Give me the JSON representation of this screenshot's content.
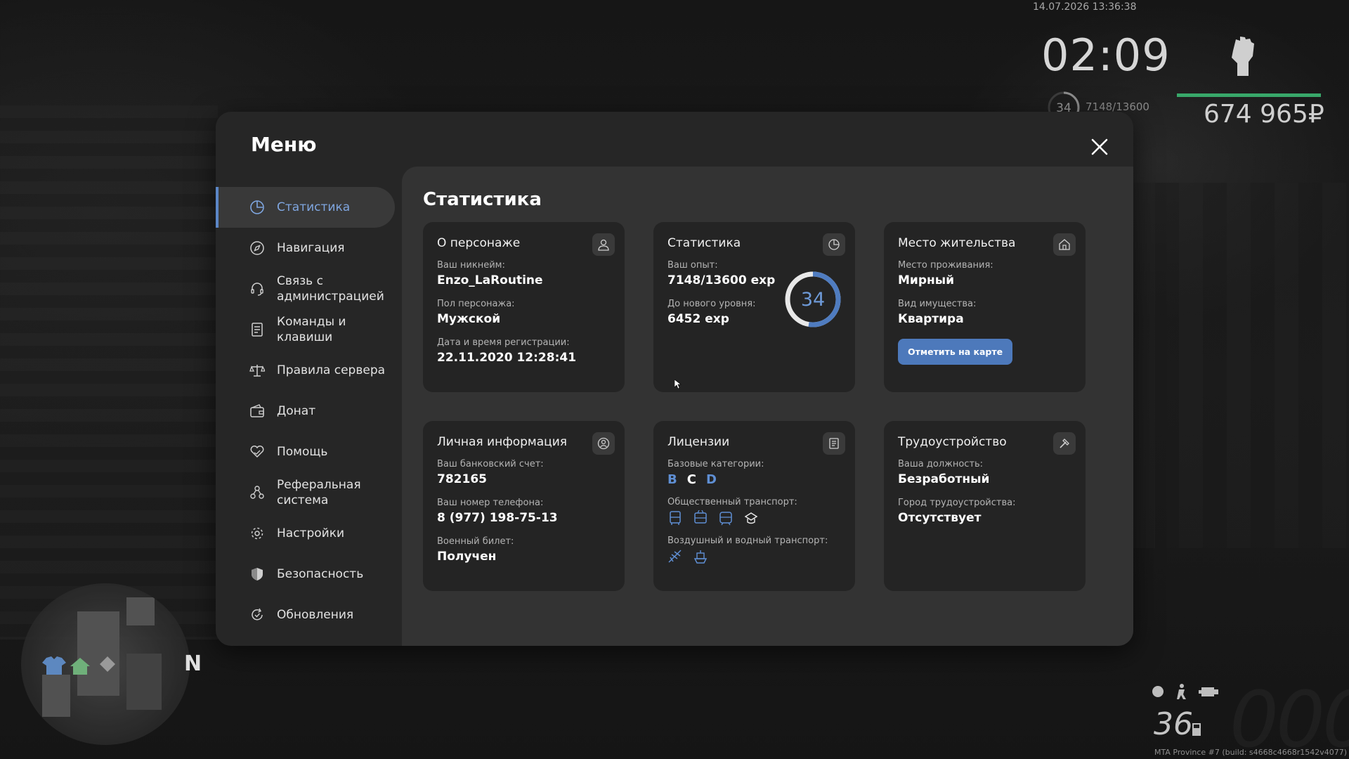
{
  "hud": {
    "datetime": "14.07.2026 13:36:38",
    "clock": "02:09",
    "level": "34",
    "exp": "7148/13600",
    "money": "674 965₽",
    "speed": "36",
    "speed_ghost": "000",
    "build": "MTA Province #7 (build: s4668c4668r1542v4077)",
    "minimap_north": "N"
  },
  "menu": {
    "title": "Меню",
    "items": [
      {
        "label": "Статистика",
        "icon": "chart-icon",
        "active": true
      },
      {
        "label": "Навигация",
        "icon": "compass-icon"
      },
      {
        "label": "Связь с\nадминистрацией",
        "icon": "headset-icon"
      },
      {
        "label": "Команды и\nклавиши",
        "icon": "document-icon"
      },
      {
        "label": "Правила сервера",
        "icon": "scales-icon"
      },
      {
        "label": "Донат",
        "icon": "wallet-icon"
      },
      {
        "label": "Помощь",
        "icon": "heart-hands-icon"
      },
      {
        "label": "Реферальная\nсистема",
        "icon": "referral-icon"
      },
      {
        "label": "Настройки",
        "icon": "gear-icon"
      },
      {
        "label": "Безопасность",
        "icon": "shield-icon"
      },
      {
        "label": "Обновления",
        "icon": "refresh-icon"
      }
    ]
  },
  "content": {
    "title": "Статистика",
    "character": {
      "title": "О персонаже",
      "nickname_label": "Ваш никнейм:",
      "nickname": "Enzo_LaRoutine",
      "gender_label": "Пол персонажа:",
      "gender": "Мужской",
      "reg_label": "Дата и время регистрации:",
      "reg": "22.11.2020 12:28:41"
    },
    "stats": {
      "title": "Статистика",
      "exp_label": "Ваш опыт:",
      "exp": "7148/13600 exp",
      "next_label": "До нового уровня:",
      "next": "6452 exp",
      "level": "34",
      "progress": 0.5256
    },
    "residence": {
      "title": "Место жительства",
      "place_label": "Место проживания:",
      "place": "Мирный",
      "property_label": "Вид имущества:",
      "property": "Квартира",
      "map_button": "Отметить на карте"
    },
    "personal": {
      "title": "Личная информация",
      "bank_label": "Ваш банковский счет:",
      "bank": "782165",
      "phone_label": "Ваш номер телефона:",
      "phone": "8 (977) 198-75-13",
      "military_label": "Военный билет:",
      "military": "Получен"
    },
    "licenses": {
      "title": "Лицензии",
      "base_label": "Базовые категории:",
      "cat_b": "B",
      "cat_c": "C",
      "cat_d": "D",
      "public_label": "Общественный транспорт:",
      "air_label": "Воздушный и водный транспорт:"
    },
    "employment": {
      "title": "Трудоустройство",
      "position_label": "Ваша должность:",
      "position": "Безработный",
      "city_label": "Город трудоустройства:",
      "city": "Отсутствует"
    }
  },
  "colors": {
    "accent": "#5b86c6",
    "button": "#4d79bb",
    "health": "#38a86a"
  }
}
